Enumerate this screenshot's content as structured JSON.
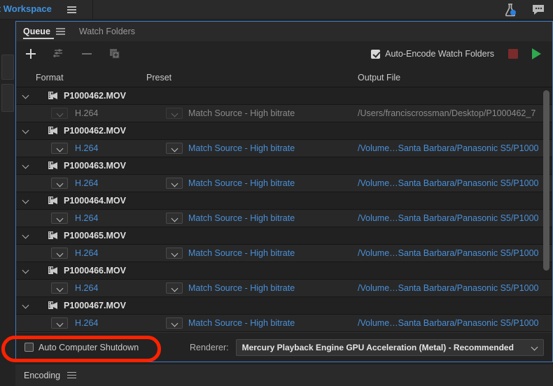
{
  "app": {
    "workspace_label": "ault Workspace",
    "workspace_menu_icon": "hamburger-icon",
    "lab_icon": "beaker-icon",
    "chat_icon": "chat-bubble-icon"
  },
  "panel": {
    "tabs": [
      {
        "label": "Queue",
        "active": true,
        "menu_icon": "hamburger-icon"
      },
      {
        "label": "Watch Folders",
        "active": false
      }
    ]
  },
  "toolbar": {
    "add_icon": "plus-icon",
    "preset_icon": "preset-sliders-icon",
    "remove_icon": "minus-icon",
    "duplicate_icon": "duplicate-icon",
    "auto_encode_label": "Auto-Encode Watch Folders",
    "auto_encode_checked": true,
    "stop_icon": "stop-square-icon",
    "stop_color": "#7a2b2b",
    "play_icon": "play-triangle-icon",
    "play_color": "#2fa84f"
  },
  "columns": {
    "format": "Format",
    "preset": "Preset",
    "output": "Output File"
  },
  "queue": [
    {
      "name": "P1000462.MOV",
      "icon": "film-clip-icon",
      "format": "H.264",
      "preset": "Match Source - High bitrate",
      "output": "/Users/franciscrossman/Desktop/P1000462_7",
      "disabled": true
    },
    {
      "name": "P1000462.MOV",
      "icon": "film-clip-icon",
      "format": "H.264",
      "preset": "Match Source - High bitrate",
      "output": "/Volume…Santa Barbara/Panasonic S5/P1000",
      "disabled": false
    },
    {
      "name": "P1000463.MOV",
      "icon": "film-clip-icon",
      "format": "H.264",
      "preset": "Match Source - High bitrate",
      "output": "/Volume…Santa Barbara/Panasonic S5/P1000",
      "disabled": false
    },
    {
      "name": "P1000464.MOV",
      "icon": "film-clip-icon",
      "format": "H.264",
      "preset": "Match Source - High bitrate",
      "output": "/Volume…Santa Barbara/Panasonic S5/P1000",
      "disabled": false
    },
    {
      "name": "P1000465.MOV",
      "icon": "film-clip-icon",
      "format": "H.264",
      "preset": "Match Source - High bitrate",
      "output": "/Volume…Santa Barbara/Panasonic S5/P1000",
      "disabled": false
    },
    {
      "name": "P1000466.MOV",
      "icon": "film-clip-icon",
      "format": "H.264",
      "preset": "Match Source - High bitrate",
      "output": "/Volume…Santa Barbara/Panasonic S5/P1000",
      "disabled": false
    },
    {
      "name": "P1000467.MOV",
      "icon": "film-clip-icon",
      "format": "H.264",
      "preset": "Match Source - High bitrate",
      "output": "/Volume…Santa Barbara/Panasonic S5/P1000",
      "disabled": false
    }
  ],
  "bottom": {
    "shutdown_label": "Auto Computer Shutdown",
    "shutdown_checked": false,
    "renderer_label": "Renderer:",
    "renderer_value": "Mercury Playback Engine GPU Acceleration (Metal) - Recommended",
    "renderer_caret_icon": "chevron-down-icon"
  },
  "encoding_panel": {
    "tab_label": "Encoding",
    "menu_icon": "hamburger-icon"
  },
  "annotation": {
    "shape": "rounded-rect-highlight",
    "color": "#ff2200",
    "target": "Auto Computer Shutdown"
  },
  "colors": {
    "accent_blue": "#4a90d9",
    "panel_border": "#3d7cc9",
    "annotation_red": "#ff2200"
  }
}
